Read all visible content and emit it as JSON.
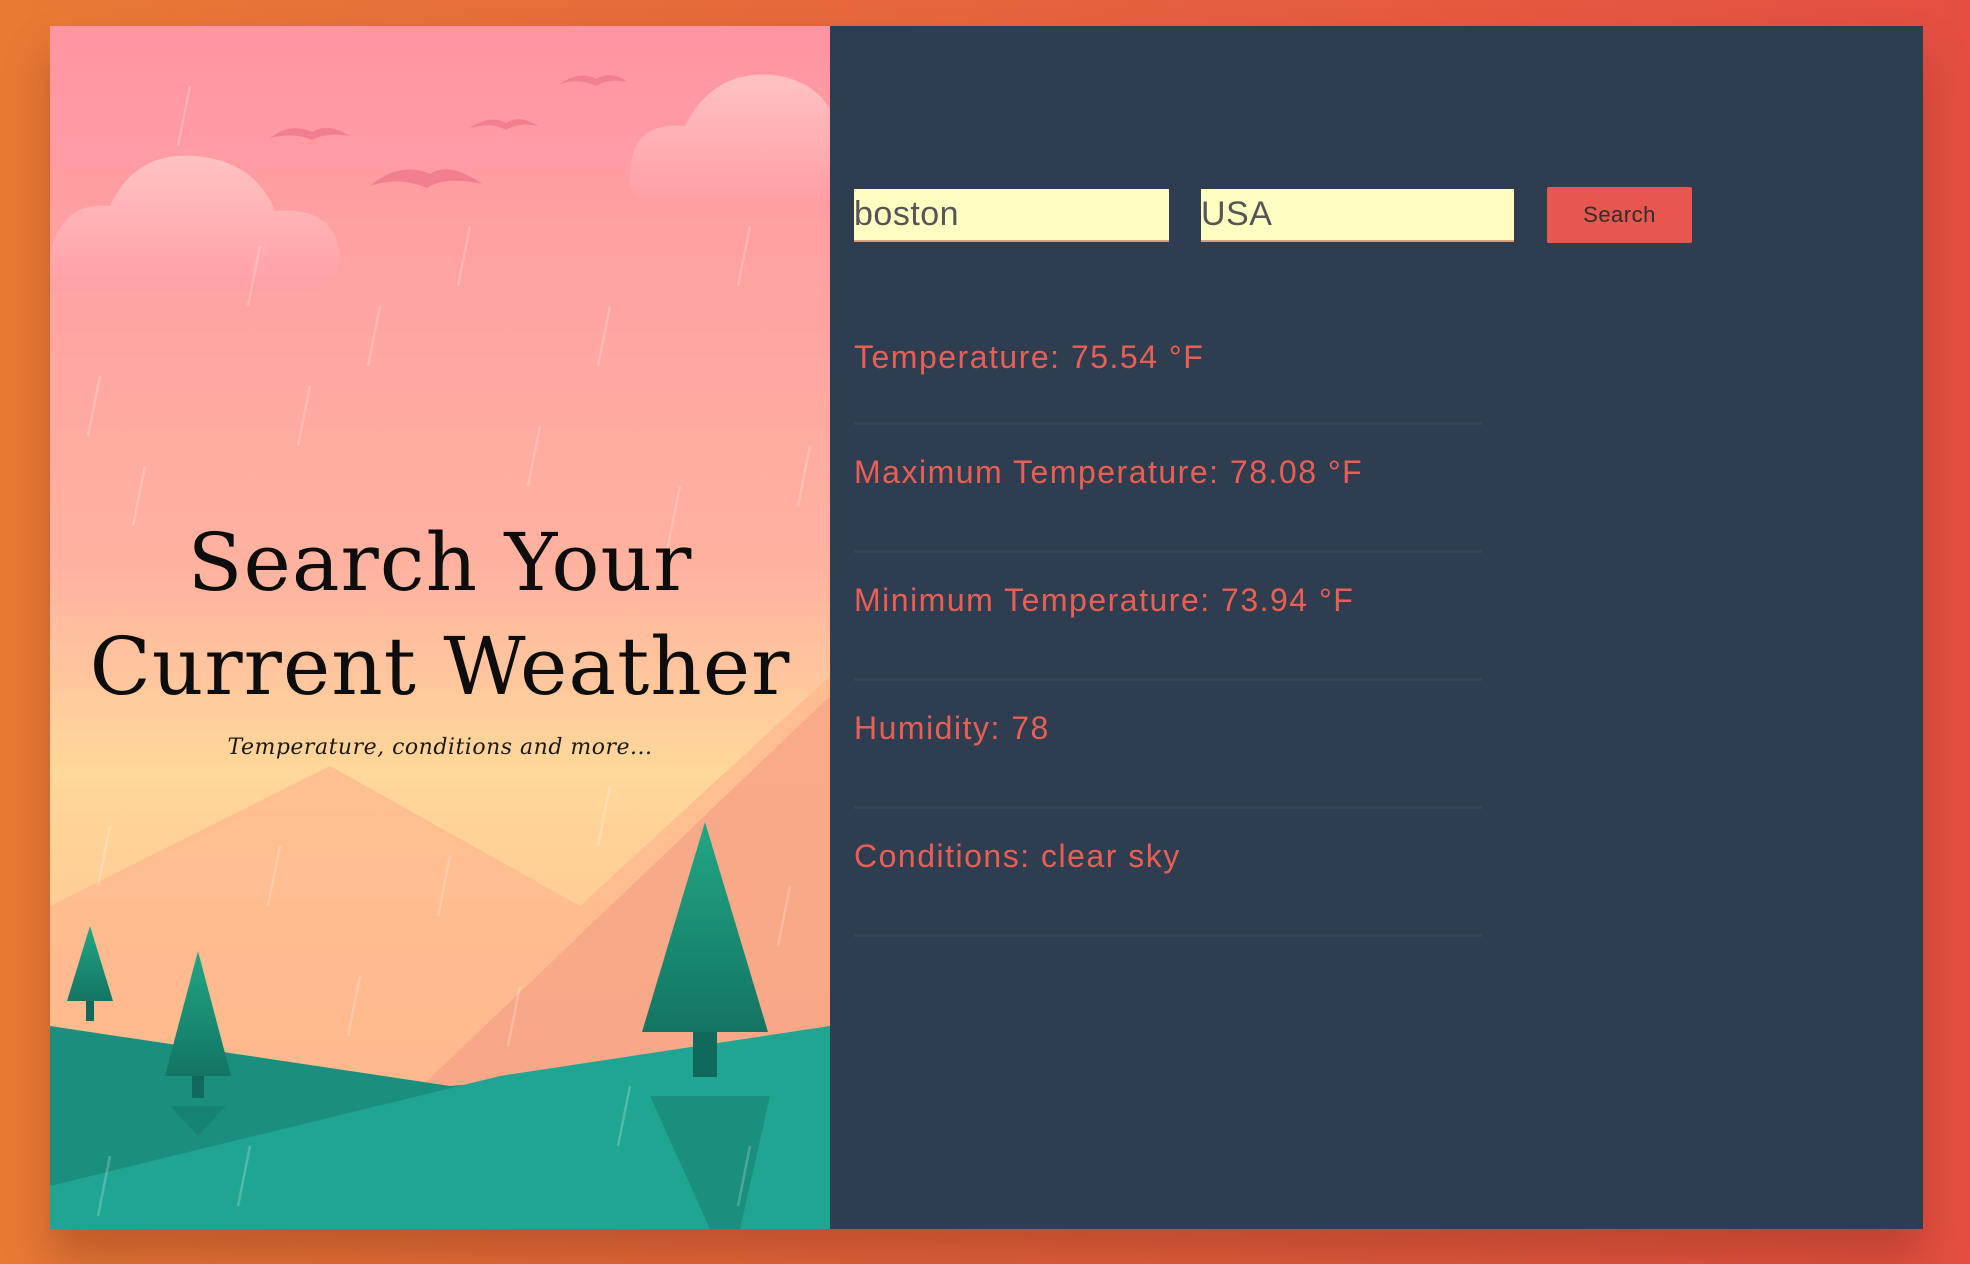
{
  "hero": {
    "title": "Search Your\nCurrent Weather",
    "subtitle": "Temperature, conditions and more..."
  },
  "search": {
    "city_value": "boston",
    "country_value": "USA",
    "button_label": "Search"
  },
  "results": [
    {
      "label": "Temperature: 75.54 °F"
    },
    {
      "label": "Maximum Temperature: 78.08 °F"
    },
    {
      "label": "Minimum Temperature: 73.94 °F"
    },
    {
      "label": "Humidity: 78"
    },
    {
      "label": "Conditions: clear sky"
    }
  ],
  "colors": {
    "background": "#e5603e",
    "panel": "#2e3d4f",
    "accent": "#ea5f53",
    "input": "#fdffc2"
  },
  "icons": [
    "bird-icon",
    "cloud-icon",
    "tree-icon",
    "mountain-icon"
  ]
}
